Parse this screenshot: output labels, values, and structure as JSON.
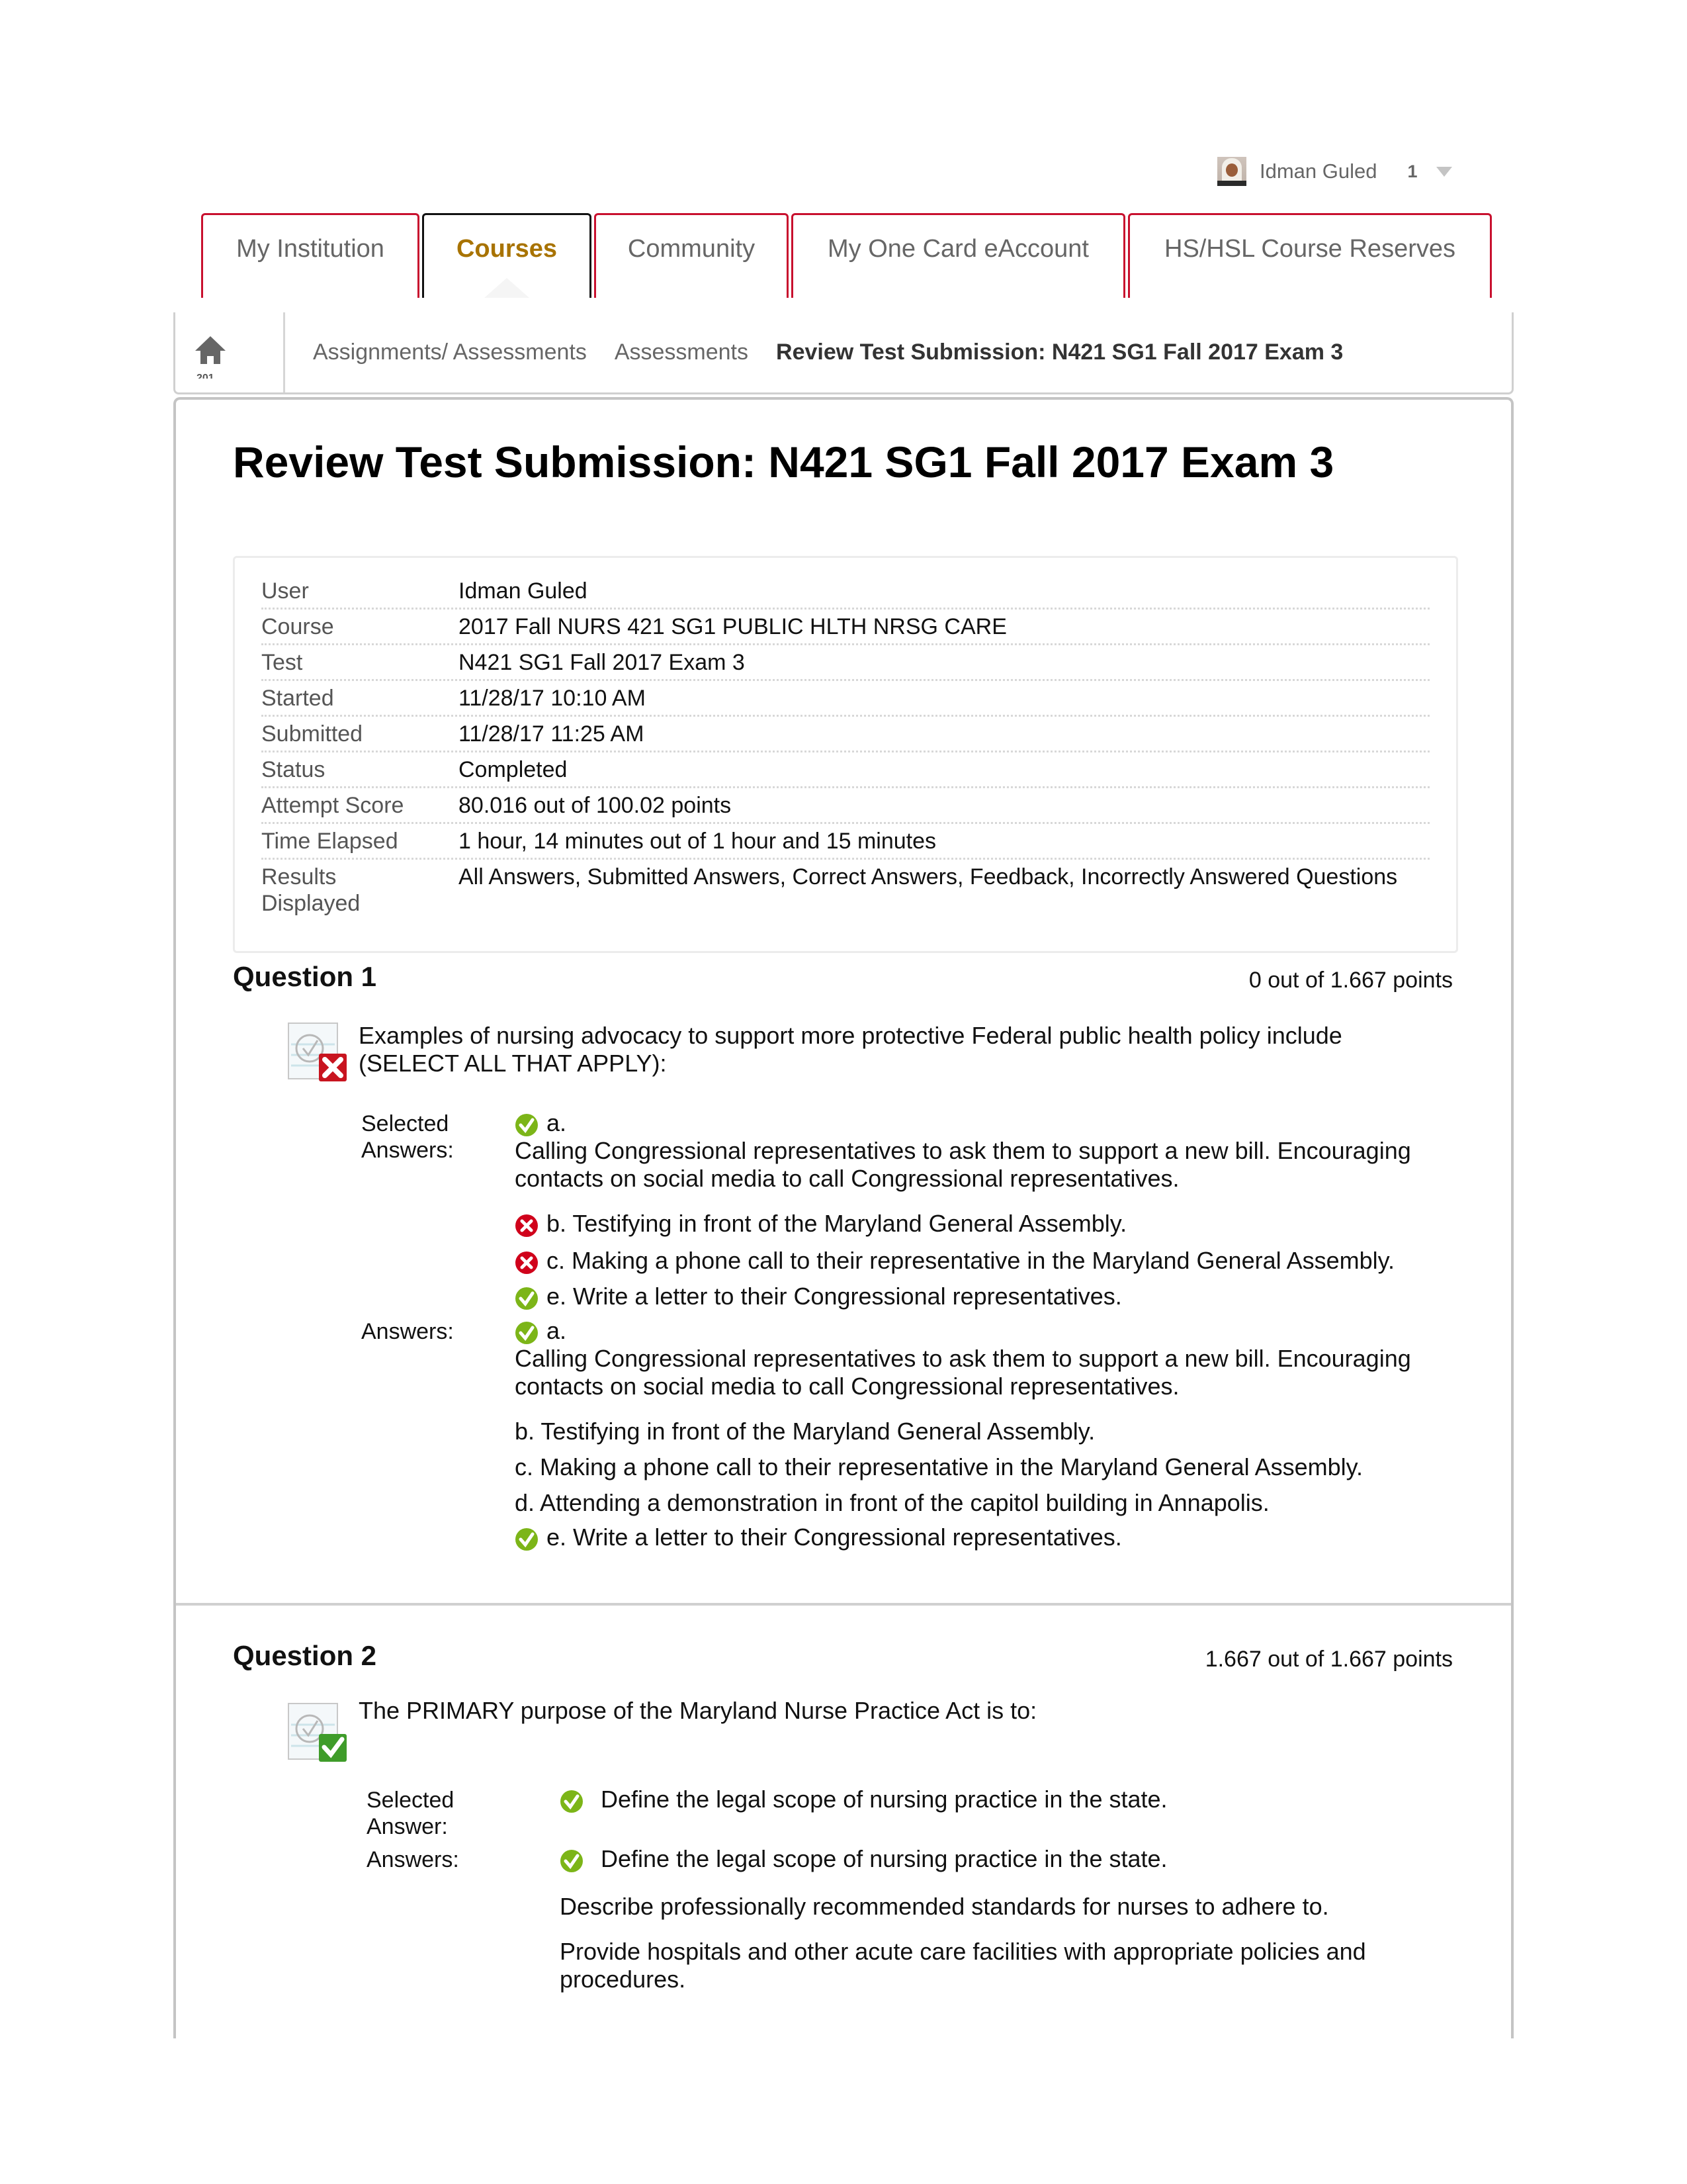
{
  "user_bar": {
    "name": "Idman Guled",
    "notification_count": "1",
    "avatar_icon": "user-avatar"
  },
  "tabs": [
    {
      "label": "My Institution",
      "active": false
    },
    {
      "label": "Courses",
      "active": true
    },
    {
      "label": "Community",
      "active": false
    },
    {
      "label": "My One Card eAccount",
      "active": false
    },
    {
      "label": "HS/HSL Course Reserves",
      "active": false
    }
  ],
  "colors": {
    "tab_border": "#c8102e",
    "active_tab_text": "#a87300",
    "correct_green": "#7cb518",
    "incorrect_red": "#d0021b"
  },
  "breadcrumb": {
    "home_icon": "home-icon",
    "home_subtext": "201",
    "items": [
      "Assignments/ Assessments",
      "Assessments"
    ],
    "current": "Review Test Submission: N421 SG1 Fall 2017 Exam 3"
  },
  "page": {
    "title": "Review Test Submission: N421 SG1 Fall 2017 Exam 3"
  },
  "info": [
    {
      "label": "User",
      "value": "Idman Guled"
    },
    {
      "label": "Course",
      "value": "2017 Fall NURS 421 SG1 PUBLIC HLTH NRSG CARE"
    },
    {
      "label": "Test",
      "value": "N421 SG1 Fall 2017 Exam 3"
    },
    {
      "label": "Started",
      "value": "11/28/17 10:10 AM"
    },
    {
      "label": "Submitted",
      "value": "11/28/17 11:25 AM"
    },
    {
      "label": "Status",
      "value": "Completed"
    },
    {
      "label": "Attempt Score",
      "value": "80.016 out of 100.02 points"
    },
    {
      "label": "Time Elapsed",
      "value": "1 hour, 14 minutes out of 1 hour and 15 minutes"
    },
    {
      "label": "Results Displayed",
      "value": "All Answers, Submitted Answers, Correct Answers, Feedback, Incorrectly Answered Questions"
    }
  ],
  "questions": [
    {
      "title": "Question 1",
      "points": "0 out of 1.667 points",
      "result": "incorrect",
      "text": "Examples of nursing advocacy to support more protective Federal public health policy include (SELECT ALL THAT APPLY):",
      "selected_label": "Selected Answers:",
      "selected": [
        {
          "text": "a.",
          "subtext": "Calling Congressional representatives to ask them to support a new bill. Encouraging contacts on social media to call Congressional representatives.",
          "mark": "correct"
        },
        {
          "text": "b. Testifying in front of the Maryland General Assembly.",
          "mark": "incorrect"
        },
        {
          "text": "c. Making a phone call to their representative in the Maryland General Assembly.",
          "mark": "incorrect"
        },
        {
          "text": "e. Write a letter to their Congressional representatives.",
          "mark": "correct"
        }
      ],
      "answers_label": "Answers:",
      "answers": [
        {
          "text": "a.",
          "subtext": "Calling Congressional representatives to ask them to support a new bill. Encouraging contacts on social media to call Congressional representatives.",
          "mark": "correct"
        },
        {
          "text": "b. Testifying in front of the Maryland General Assembly.",
          "mark": "none"
        },
        {
          "text": "c. Making a phone call to their representative in the Maryland General Assembly.",
          "mark": "none"
        },
        {
          "text": "d. Attending a demonstration in front of the capitol building in Annapolis.",
          "mark": "none"
        },
        {
          "text": "e. Write a letter to their Congressional representatives.",
          "mark": "correct"
        }
      ]
    },
    {
      "title": "Question 2",
      "points": "1.667 out of 1.667 points",
      "result": "correct",
      "text": "The PRIMARY purpose of the Maryland Nurse Practice Act is to:",
      "selected_label": "Selected Answer:",
      "selected": [
        {
          "text": "Define the legal scope of nursing practice in the state.",
          "mark": "correct"
        }
      ],
      "answers_label": "Answers:",
      "answers": [
        {
          "text": "Define the legal scope of nursing practice in the state.",
          "mark": "correct"
        },
        {
          "text": "Describe professionally recommended standards for nurses to adhere to.",
          "mark": "none"
        },
        {
          "text": "Provide hospitals and other acute care facilities with appropriate policies and procedures.",
          "mark": "none"
        }
      ]
    }
  ]
}
